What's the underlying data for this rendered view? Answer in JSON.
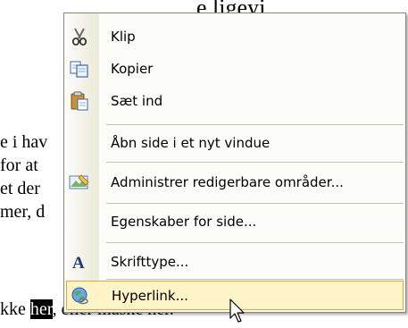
{
  "document": {
    "heading_fragment": "e ligeyj",
    "lines": [
      {
        "text": "e i hav"
      },
      {
        "text": " for at"
      },
      {
        "text": "et der"
      },
      {
        "text": "mer, d"
      }
    ],
    "bottom_line": {
      "prefix": "kke ",
      "highlight": "her",
      "suffix": ", eller måske her."
    }
  },
  "menu": {
    "items": [
      {
        "label": "Klip",
        "icon": "scissors-icon"
      },
      {
        "label": "Kopier",
        "icon": "copy-icon"
      },
      {
        "label": "Sæt ind",
        "icon": "paste-icon"
      },
      {
        "label": "Åbn side i et nyt vindue",
        "icon": ""
      },
      {
        "label": "Administrer redigerbare områder...",
        "icon": "editable-regions-icon"
      },
      {
        "label": "Egenskaber for side...",
        "icon": ""
      },
      {
        "label": "Skrifttype...",
        "icon": "font-icon"
      },
      {
        "label": "Hyperlink...",
        "icon": "hyperlink-globe-icon"
      }
    ]
  }
}
